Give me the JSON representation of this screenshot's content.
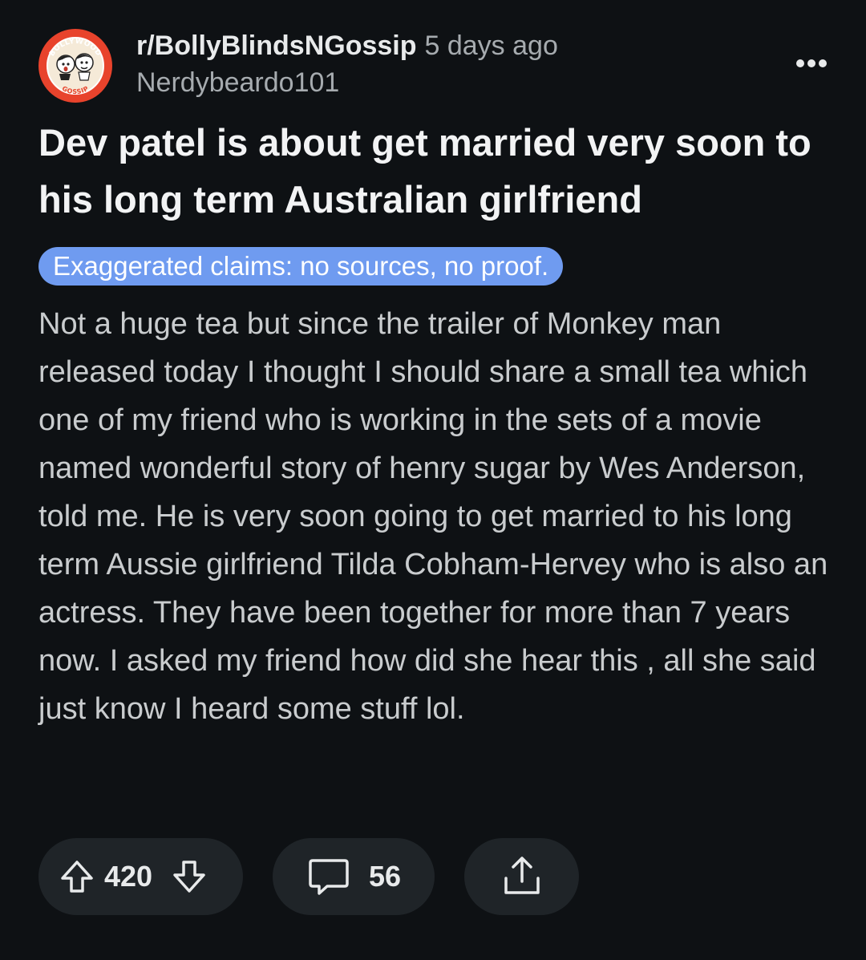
{
  "header": {
    "subreddit": "r/BollyBlindsNGossip",
    "time_ago": "5 days ago",
    "author": "Nerdybeardo101",
    "avatar": {
      "top_text": "BOLLYWOOD",
      "bottom_text": "GOSSIP",
      "background_color": "#e8432c"
    },
    "more_icon": "more-options-icon"
  },
  "post": {
    "title": "Dev patel is about get married very soon to his long term Australian girlfriend",
    "flair": "Exaggerated claims: no sources, no proof.",
    "flair_color": "#6f9bf0",
    "body": "Not a huge tea but since the trailer of Monkey man released today I thought I should share a small tea which one of my friend who is working in the sets of a movie named wonderful story of henry sugar by Wes Anderson, told me. He is very soon going to get married to his long term Aussie girlfriend Tilda Cobham-Hervey who is also an actress. They have been together for more than 7 years now. I asked my friend how did she hear this , all she said just know I heard some stuff lol."
  },
  "actions": {
    "upvote_icon": "upvote-arrow-icon",
    "vote_count": "420",
    "downvote_icon": "downvote-arrow-icon",
    "comment_icon": "comment-bubble-icon",
    "comment_count": "56",
    "share_icon": "share-icon"
  }
}
